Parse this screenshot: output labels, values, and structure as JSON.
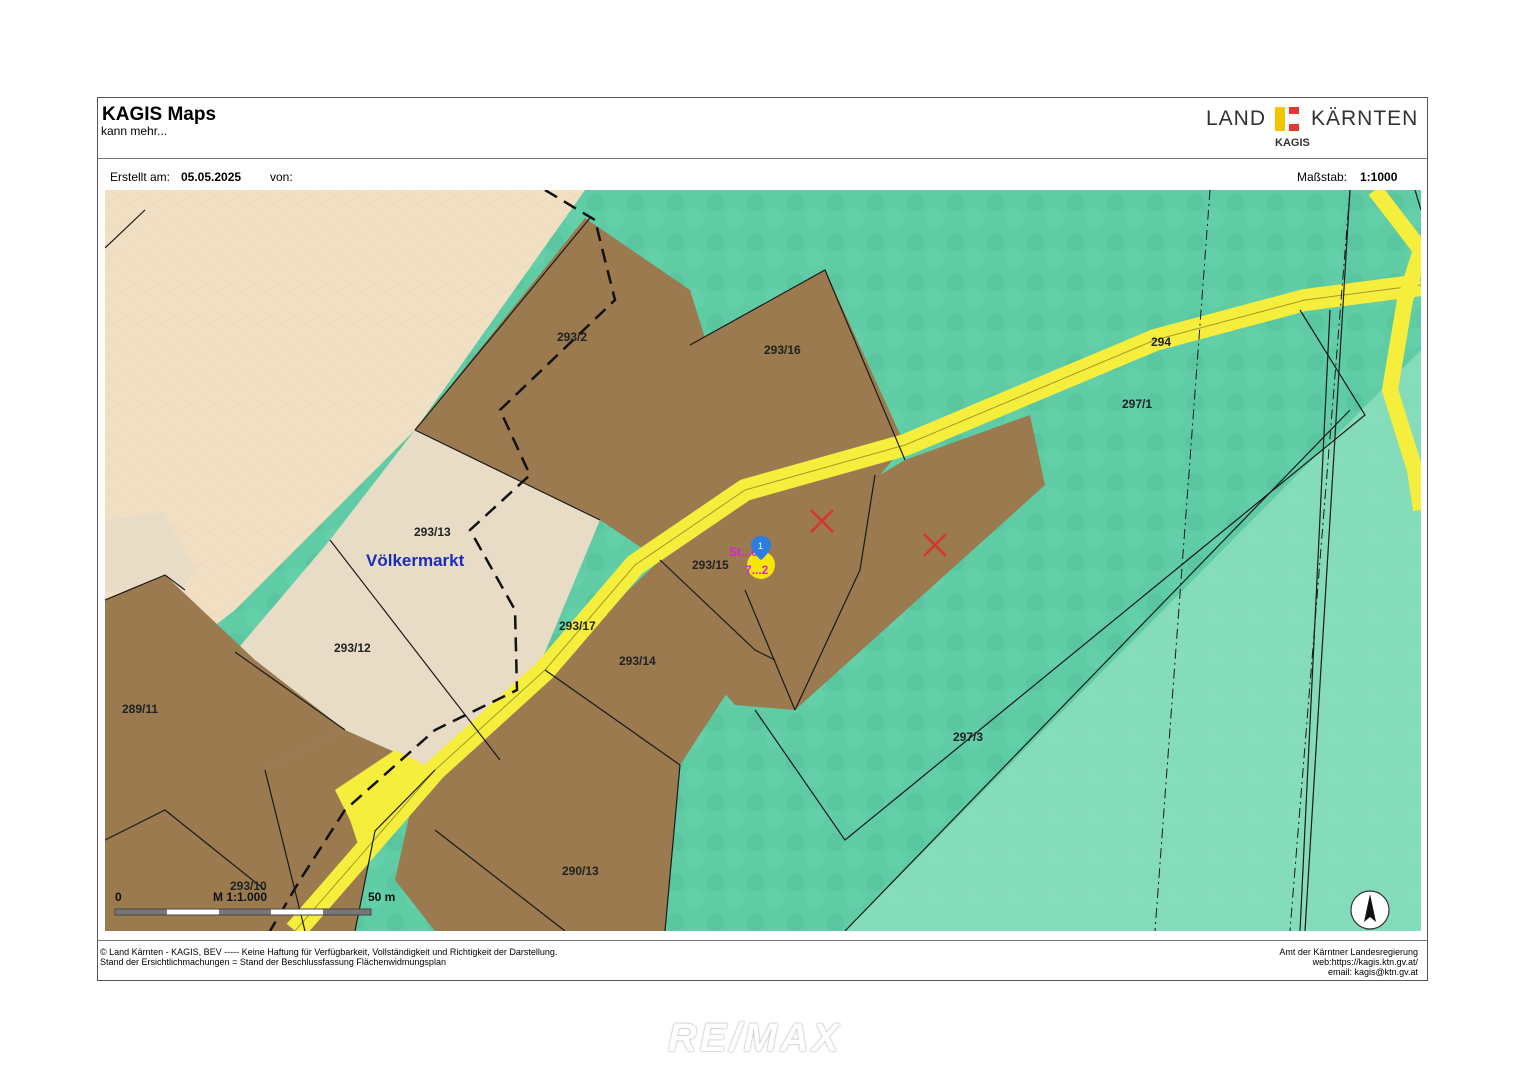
{
  "header": {
    "title": "KAGIS Maps",
    "subtitle": "kann mehr...",
    "logo": {
      "left_text": "LAND",
      "right_text": "KÄRNTEN",
      "sub_text": "KAGIS"
    }
  },
  "meta": {
    "created_label": "Erstellt am:",
    "created_date": "05.05.2025",
    "by_label": "von:",
    "scale_label": "Maßstab:",
    "scale_value": "1:1000"
  },
  "map": {
    "place_name": "Völkermarkt",
    "parcels": [
      "293/2",
      "293/16",
      "294",
      "297/1",
      "293/13",
      "293/15",
      "293/17",
      "293/14",
      "293/12",
      "289/11",
      "297/3",
      "293/10",
      "290/13"
    ],
    "marker": {
      "number": "1",
      "label_line1": "St...ob",
      "label_line2": "7...2"
    },
    "scalebar": {
      "start": "0",
      "label": "M 1:1.000",
      "end": "50 m"
    },
    "north_arrow": "north-arrow-icon"
  },
  "footer": {
    "left_line1": "© Land Kärnten - KAGIS, BEV ----- Keine Haftung für Verfügbarkeit, Vollständigkeit und Richtigkeit der Darstellung.",
    "left_line2": "Stand der Ersichtlichmachungen = Stand der Beschlussfassung Flächenwidmungsplan",
    "right_line1": "Amt der Kärntner Landesregierung",
    "right_line2": "web:https://kagis.ktn.gv.at/",
    "right_line3": "email: kagis@ktn.gv.at"
  },
  "watermark": "RE/MAX",
  "colors": {
    "forest": "#5fcca6",
    "forest_light": "#8fe0bf",
    "building": "#9a7a4e",
    "agriculture": "#f1dfc4",
    "road": "#f5ee3c"
  }
}
